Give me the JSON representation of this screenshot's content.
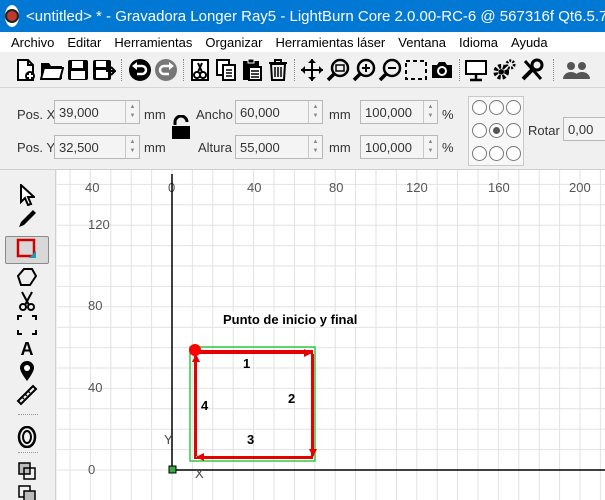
{
  "window": {
    "title": "<untitled> * - Gravadora Longer Ray5 - LightBurn Core 2.0.00-RC-6 @ 567316f Qt6.5.7"
  },
  "menu": [
    {
      "label": "Archivo"
    },
    {
      "label": "Editar"
    },
    {
      "label": "Herramientas"
    },
    {
      "label": "Organizar"
    },
    {
      "label": "Herramientas láser"
    },
    {
      "label": "Ventana"
    },
    {
      "label": "Idioma"
    },
    {
      "label": "Ayuda"
    }
  ],
  "toolbar": {
    "icons": [
      "new-file-icon",
      "open-folder-icon",
      "save-icon",
      "save-as-icon",
      "undo-icon",
      "redo-icon",
      "cut-icon",
      "copy-icon",
      "paste-icon",
      "delete-icon",
      "move-icon",
      "zoom-icon",
      "zoom-in-icon",
      "zoom-out-icon",
      "zoom-frame-icon",
      "camera-icon",
      "monitor-icon",
      "settings-icon",
      "tools-icon",
      "users-icon"
    ]
  },
  "numeric": {
    "pos_x_label": "Pos. X",
    "pos_x_value": "39,000",
    "pos_y_label": "Pos. Y",
    "pos_y_value": "32,500",
    "unit": "mm",
    "width_label": "Ancho",
    "width_value": "60,000",
    "height_label": "Altura",
    "height_value": "55,000",
    "scale_x_value": "100,000",
    "scale_y_value": "100,000",
    "percent": "%",
    "rotate_label": "Rotar",
    "rotate_value": "0,00"
  },
  "tools": [
    {
      "name": "select-tool",
      "icon": "cursor-arrow-icon",
      "active": false
    },
    {
      "name": "edit-nodes-tool",
      "icon": "pencil-icon",
      "active": false
    },
    {
      "name": "rectangle-tool",
      "icon": "rectangle-icon",
      "active": true
    },
    {
      "name": "polygon-tool",
      "icon": "polygon-icon",
      "active": false
    },
    {
      "name": "trim-tool",
      "icon": "scissors-icon",
      "active": false
    },
    {
      "name": "frame-tool",
      "icon": "frame-icon",
      "active": false
    },
    {
      "name": "text-tool",
      "icon": "text-icon",
      "active": false
    },
    {
      "name": "position-laser-tool",
      "icon": "map-pin-icon",
      "active": false
    },
    {
      "name": "measure-tool",
      "icon": "ruler-icon",
      "active": false
    },
    {
      "name": "offset-tool",
      "icon": "offset-icon",
      "active": false
    },
    {
      "name": "boolean-tool",
      "icon": "boolean-icon",
      "active": false
    }
  ],
  "canvas": {
    "top_ruler": [
      "40",
      "0",
      "40",
      "80",
      "120",
      "160",
      "200"
    ],
    "left_ruler": [
      "120",
      "80",
      "40",
      "0"
    ],
    "axis_x": "X",
    "axis_y": "Y",
    "annotation": "Punto de inicio y final",
    "side_labels": [
      "1",
      "2",
      "3",
      "4"
    ],
    "colors": {
      "grid": "#e2e2e2",
      "selection": "#2ecc40",
      "shape": "#e60000",
      "start_point": "#ff0000"
    }
  }
}
